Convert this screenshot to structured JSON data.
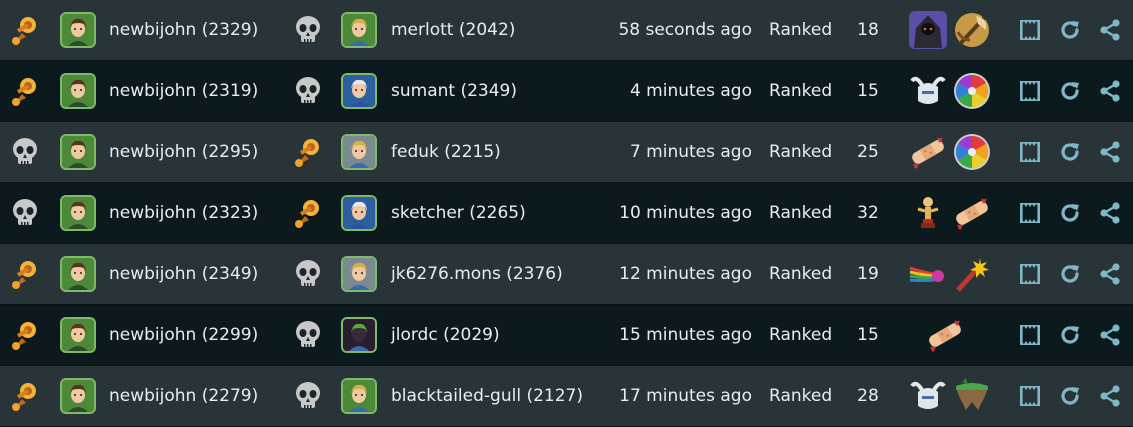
{
  "games": [
    {
      "result1": "winner-icon",
      "player1": "newbijohn (2329)",
      "result2": "skull-icon",
      "player2": "merlott (2042)",
      "avatar2": "green",
      "time": "58 seconds ago",
      "mode": "Ranked",
      "turns": "18",
      "badges": [
        "hooded-figure-icon",
        "crossed-axe-icon"
      ]
    },
    {
      "result1": "winner-icon",
      "player1": "newbijohn (2319)",
      "result2": "skull-icon",
      "player2": "sumant (2349)",
      "avatar2": "blue",
      "time": "4 minutes ago",
      "mode": "Ranked",
      "turns": "15",
      "badges": [
        "horned-helmet-icon",
        "color-wheel-icon"
      ]
    },
    {
      "result1": "skull-icon",
      "player1": "newbijohn (2295)",
      "result2": "winner-icon",
      "player2": "feduk (2215)",
      "avatar2": "gray",
      "time": "7 minutes ago",
      "mode": "Ranked",
      "turns": "25",
      "badges": [
        "bandage-icon",
        "color-wheel-icon"
      ]
    },
    {
      "result1": "skull-icon",
      "player1": "newbijohn (2323)",
      "result2": "winner-icon",
      "player2": "sketcher (2265)",
      "avatar2": "blue",
      "time": "10 minutes ago",
      "mode": "Ranked",
      "turns": "32",
      "badges": [
        "trophy-statue-icon",
        "bandage-icon"
      ]
    },
    {
      "result1": "winner-icon",
      "player1": "newbijohn (2349)",
      "result2": "skull-icon",
      "player2": "jk6276.mons (2376)",
      "avatar2": "gray",
      "time": "12 minutes ago",
      "mode": "Ranked",
      "turns": "19",
      "badges": [
        "rainbow-trail-icon",
        "fireworks-icon"
      ]
    },
    {
      "result1": "winner-icon",
      "player1": "newbijohn (2299)",
      "result2": "skull-icon",
      "player2": "jlordc (2029)",
      "avatar2": "dark",
      "time": "15 minutes ago",
      "mode": "Ranked",
      "turns": "15",
      "badges": [
        "bandage-icon"
      ]
    },
    {
      "result1": "winner-icon",
      "player1": "newbijohn (2279)",
      "result2": "skull-icon",
      "player2": "blacktailed-gull (2127)",
      "avatar2": "green",
      "time": "17 minutes ago",
      "mode": "Ranked",
      "turns": "28",
      "badges": [
        "horned-helmet-icon",
        "floating-island-icon"
      ]
    }
  ],
  "colors": {
    "row_light": "#283438",
    "row_dark": "#0c1a1e",
    "action": "#7fb7c8",
    "trophy": "#e09a2c",
    "skull": "#c8c8c8"
  }
}
